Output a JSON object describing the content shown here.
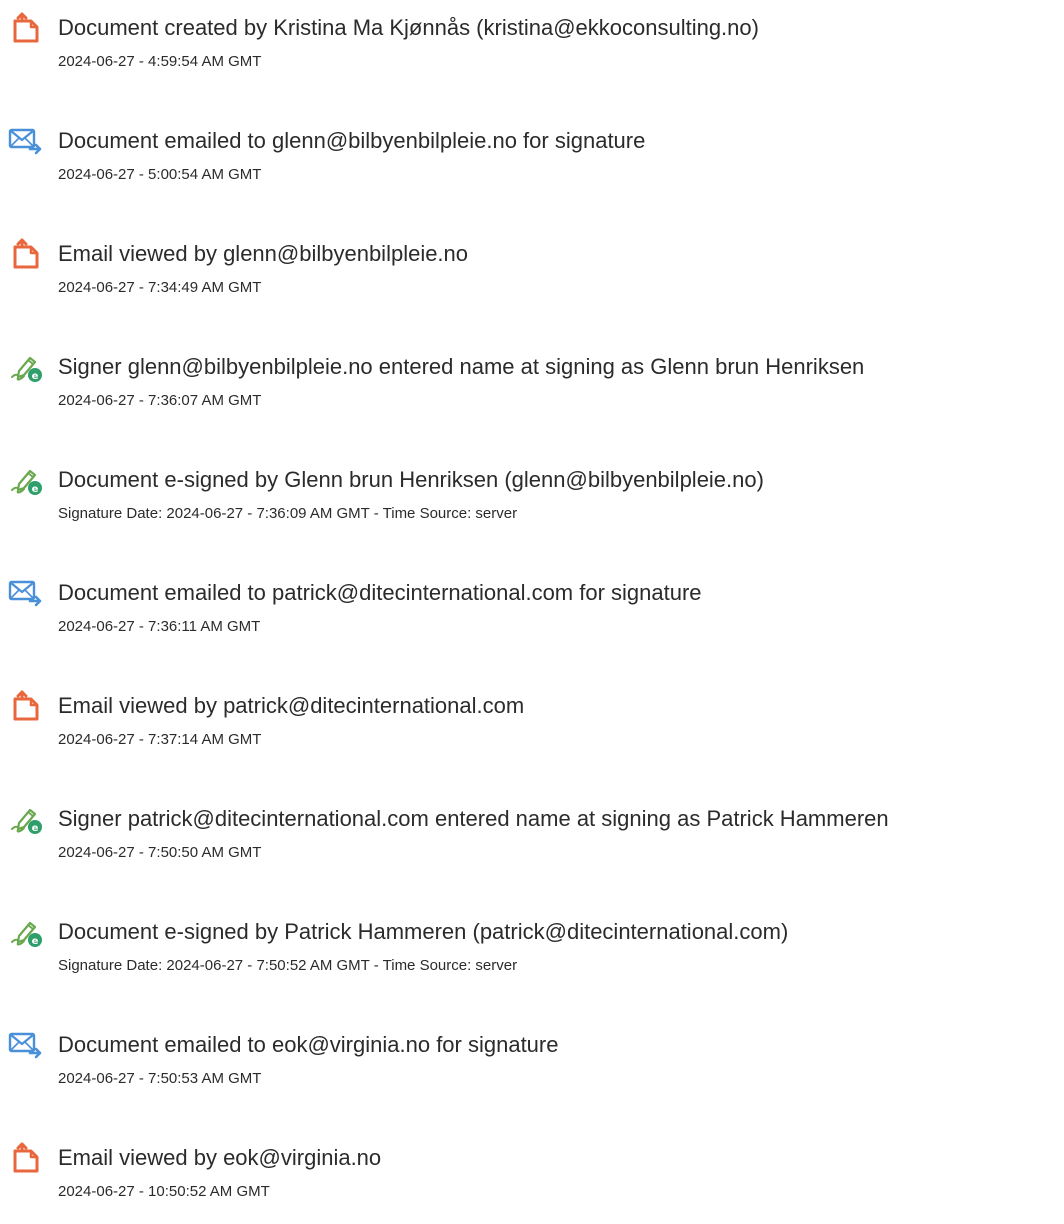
{
  "colors": {
    "text": "#2b2b2b",
    "doc_icon": "#e8673c",
    "email_icon": "#4a90d9",
    "sign_icon_pen": "#6aa84f",
    "sign_icon_badge": "#2e9e6a"
  },
  "events": [
    {
      "icon": "document-created-icon",
      "title": "Document created by Kristina Ma Kjønnås (kristina@ekkoconsulting.no)",
      "time": "2024-06-27 - 4:59:54 AM GMT"
    },
    {
      "icon": "email-sent-icon",
      "title": "Document emailed to glenn@bilbyenbilpleie.no for signature",
      "time": "2024-06-27 - 5:00:54 AM GMT"
    },
    {
      "icon": "document-viewed-icon",
      "title": "Email viewed by glenn@bilbyenbilpleie.no",
      "time": "2024-06-27 - 7:34:49 AM GMT"
    },
    {
      "icon": "e-sign-icon",
      "title": "Signer glenn@bilbyenbilpleie.no entered name at signing as Glenn brun Henriksen",
      "time": "2024-06-27 - 7:36:07 AM GMT"
    },
    {
      "icon": "e-sign-icon",
      "title": "Document e-signed by Glenn brun Henriksen (glenn@bilbyenbilpleie.no)",
      "time": "Signature Date: 2024-06-27 - 7:36:09 AM GMT - Time Source: server"
    },
    {
      "icon": "email-sent-icon",
      "title": "Document emailed to patrick@ditecinternational.com for signature",
      "time": "2024-06-27 - 7:36:11 AM GMT"
    },
    {
      "icon": "document-viewed-icon",
      "title": "Email viewed by patrick@ditecinternational.com",
      "time": "2024-06-27 - 7:37:14 AM GMT"
    },
    {
      "icon": "e-sign-icon",
      "title": "Signer patrick@ditecinternational.com entered name at signing as Patrick Hammeren",
      "time": "2024-06-27 - 7:50:50 AM GMT"
    },
    {
      "icon": "e-sign-icon",
      "title": "Document e-signed by Patrick Hammeren (patrick@ditecinternational.com)",
      "time": "Signature Date: 2024-06-27 - 7:50:52 AM GMT - Time Source: server"
    },
    {
      "icon": "email-sent-icon",
      "title": "Document emailed to eok@virginia.no for signature",
      "time": "2024-06-27 - 7:50:53 AM GMT"
    },
    {
      "icon": "document-viewed-icon",
      "title": "Email viewed by eok@virginia.no",
      "time": "2024-06-27 - 10:50:52 AM GMT"
    }
  ]
}
